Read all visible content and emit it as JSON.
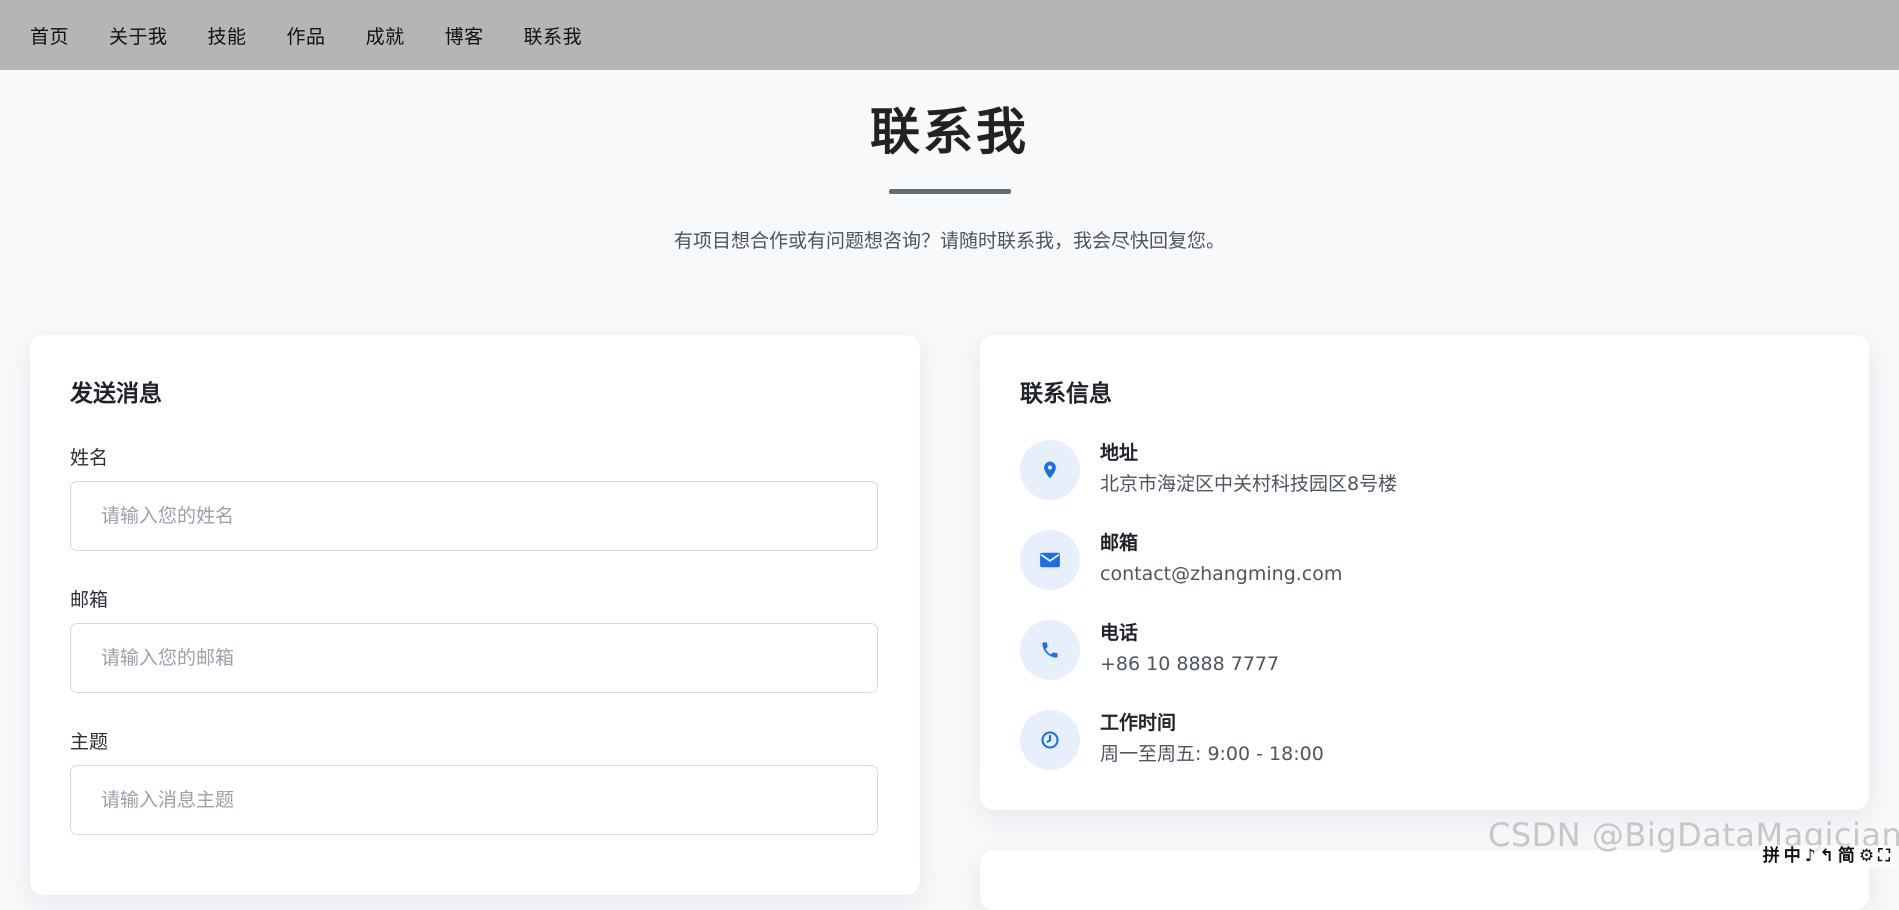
{
  "nav": {
    "items": [
      "首页",
      "关于我",
      "技能",
      "作品",
      "成就",
      "博客",
      "联系我"
    ]
  },
  "header": {
    "title": "联系我",
    "subtitle": "有项目想合作或有问题想咨询？请随时联系我，我会尽快回复您。"
  },
  "form": {
    "title": "发送消息",
    "fields": [
      {
        "label": "姓名",
        "placeholder": "请输入您的姓名",
        "value": ""
      },
      {
        "label": "邮箱",
        "placeholder": "请输入您的邮箱",
        "value": ""
      },
      {
        "label": "主题",
        "placeholder": "请输入消息主题",
        "value": ""
      }
    ]
  },
  "contact": {
    "title": "联系信息",
    "items": [
      {
        "icon": "map-pin-icon",
        "label": "地址",
        "value": "北京市海淀区中关村科技园区8号楼"
      },
      {
        "icon": "envelope-icon",
        "label": "邮箱",
        "value": "contact@zhangming.com"
      },
      {
        "icon": "phone-icon",
        "label": "电话",
        "value": "+86 10 8888 7777"
      },
      {
        "icon": "clock-icon",
        "label": "工作时间",
        "value": "周一至周五: 9:00 - 18:00"
      }
    ]
  },
  "watermark": "CSDN @BigDataMagician",
  "ime_bar": {
    "items": [
      "拼",
      "中",
      "♪",
      "↰",
      "简",
      "⚙",
      "⛶"
    ]
  },
  "colors": {
    "nav_bg": "#b5b5b5",
    "page_bg": "#f8f9fb",
    "accent": "#1a6fe8",
    "icon_bg": "#e7eefc",
    "underline": "#636b75"
  }
}
